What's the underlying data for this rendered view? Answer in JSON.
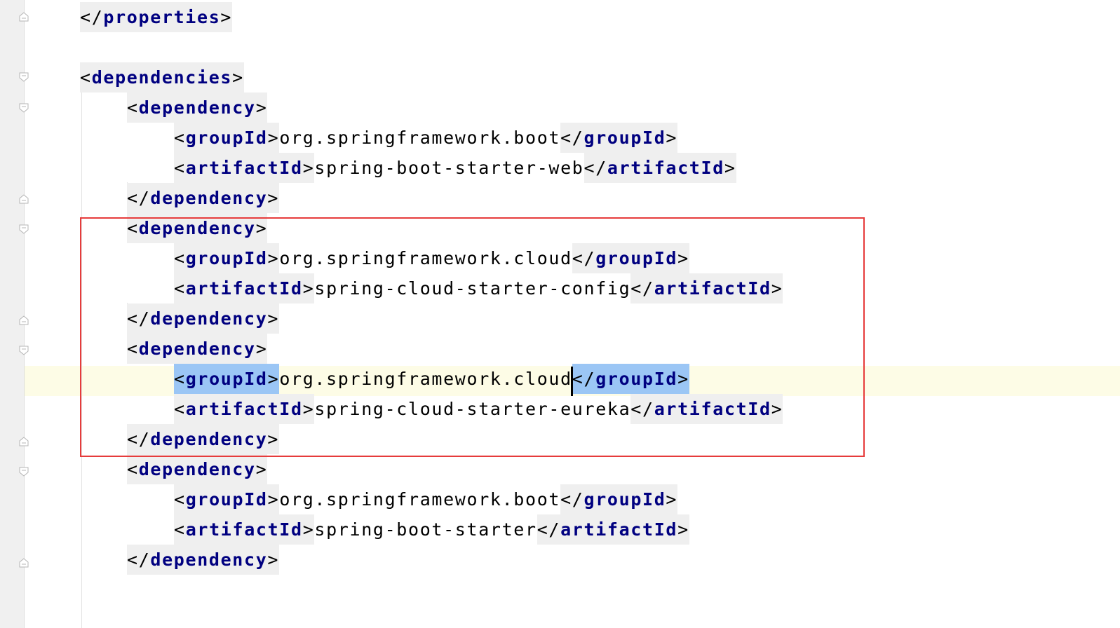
{
  "editor": {
    "lines": [
      {
        "indent": 0,
        "open": "</",
        "name": "properties",
        "close": ">"
      },
      {
        "blank": true
      },
      {
        "indent": 0,
        "open": "<",
        "name": "dependencies",
        "close": ">"
      },
      {
        "indent": 1,
        "open": "<",
        "name": "dependency",
        "close": ">"
      },
      {
        "indent": 2,
        "tag": "groupId",
        "value": "org.springframework.boot"
      },
      {
        "indent": 2,
        "tag": "artifactId",
        "value": "spring-boot-starter-web"
      },
      {
        "indent": 1,
        "open": "</",
        "name": "dependency",
        "close": ">"
      },
      {
        "indent": 1,
        "open": "<",
        "name": "dependency",
        "close": ">"
      },
      {
        "indent": 2,
        "tag": "groupId",
        "value": "org.springframework.cloud"
      },
      {
        "indent": 2,
        "tag": "artifactId",
        "value": "spring-cloud-starter-config"
      },
      {
        "indent": 1,
        "open": "</",
        "name": "dependency",
        "close": ">"
      },
      {
        "indent": 1,
        "open": "<",
        "name": "dependency",
        "close": ">"
      },
      {
        "indent": 2,
        "tag": "groupId",
        "value": "org.springframework.cloud",
        "caret": true
      },
      {
        "indent": 2,
        "tag": "artifactId",
        "value": "spring-cloud-starter-eureka"
      },
      {
        "indent": 1,
        "open": "</",
        "name": "dependency",
        "close": ">"
      },
      {
        "indent": 1,
        "open": "<",
        "name": "dependency",
        "close": ">"
      },
      {
        "indent": 2,
        "tag": "groupId",
        "value": "org.springframework.boot"
      },
      {
        "indent": 2,
        "tag": "artifactId",
        "value": "spring-boot-starter"
      },
      {
        "indent": 1,
        "open": "</",
        "name": "dependency",
        "close": ">"
      },
      {
        "blank": true
      }
    ]
  },
  "colors": {
    "tag_name": "#000080",
    "tag_background": "#efefef",
    "matched_tag_background": "#9bc6f5",
    "caret_line": "#fdfce6",
    "highlight_box": "#e63b3b"
  },
  "icons": {
    "fold_open": "fold-open-icon",
    "fold_end": "fold-end-icon"
  }
}
